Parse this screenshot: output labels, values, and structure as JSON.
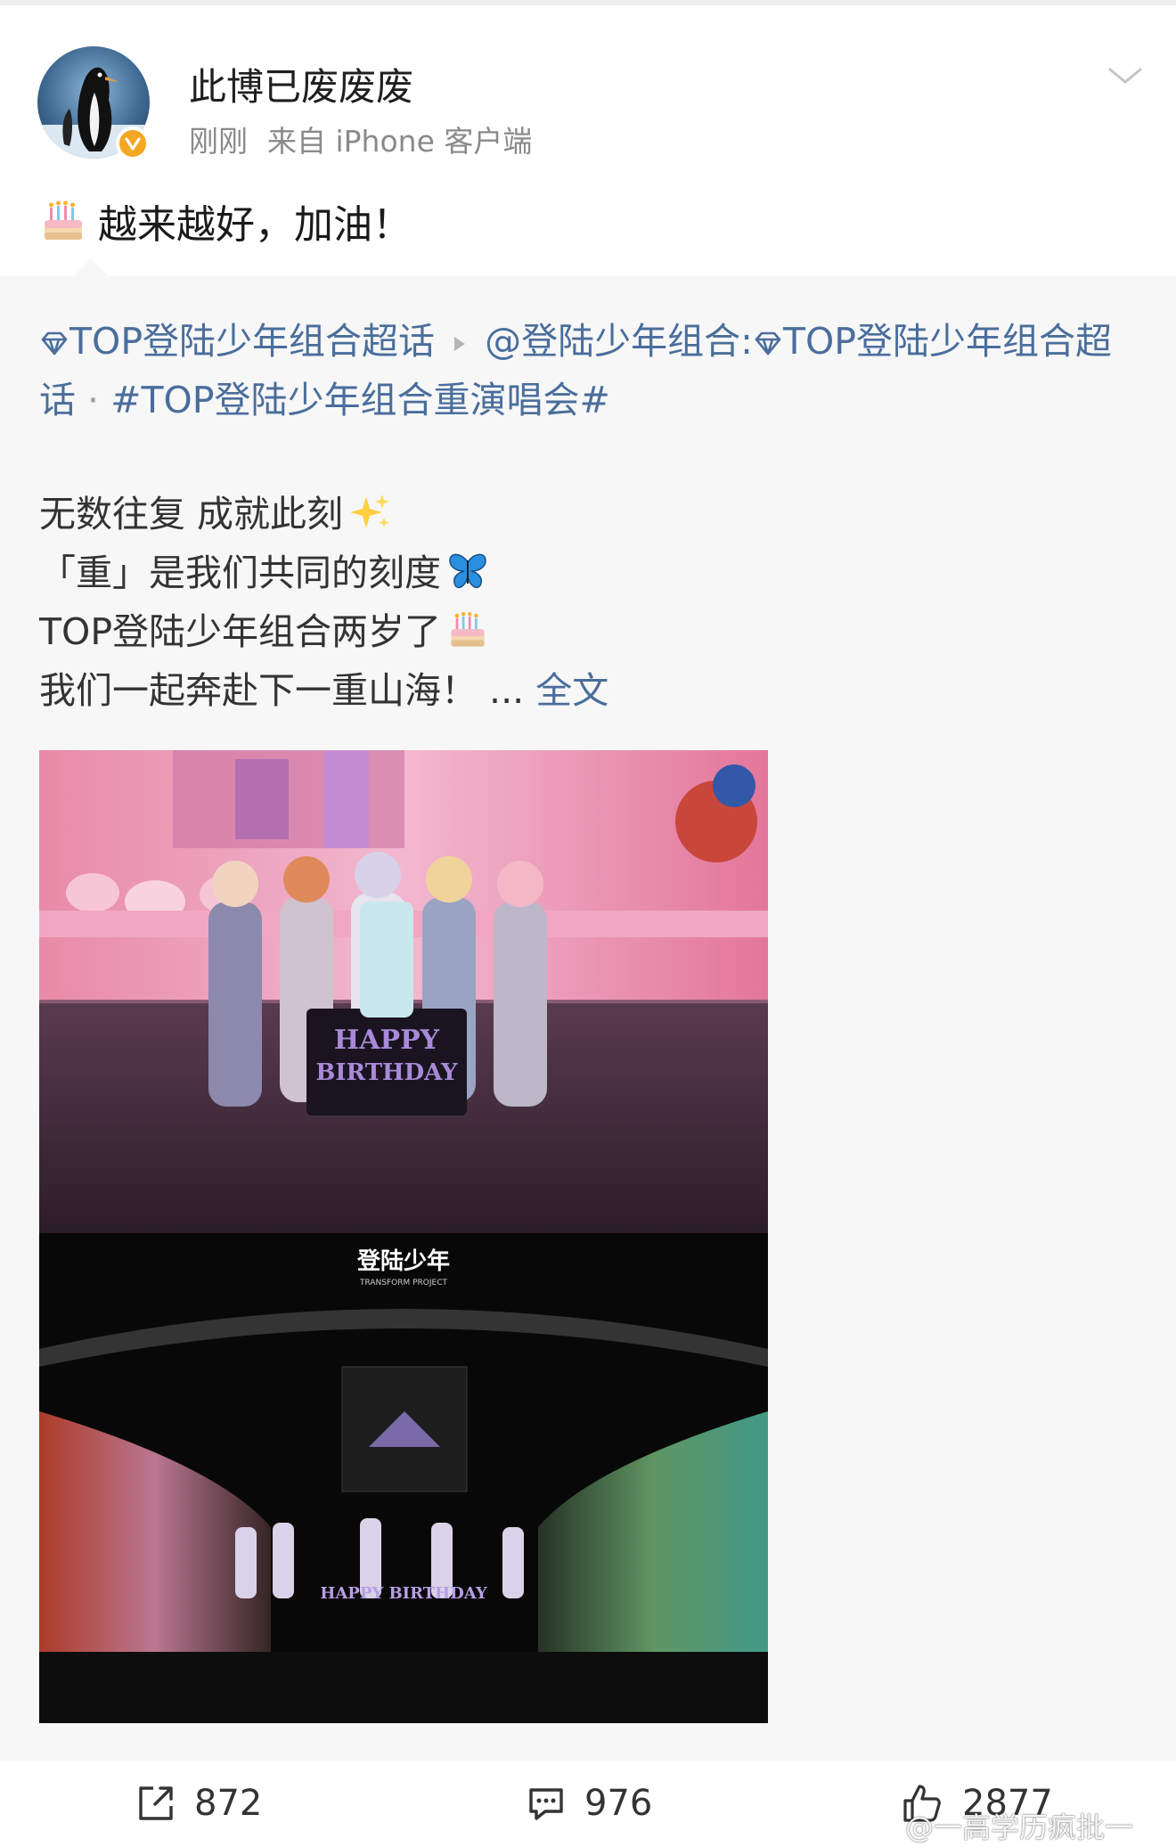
{
  "post": {
    "username": "此博已废废废",
    "time": "刚刚",
    "source": "来自 iPhone 客户端",
    "comment_text": "越来越好，加油！",
    "cake_icon": "cake-icon"
  },
  "repost": {
    "supertopic_1": "TOP登陆少年组合超话",
    "mention": "@登陆少年组合:",
    "supertopic_2": "TOP登陆少年组合超话",
    "separator": "·",
    "hashtag": "#TOP登陆少年组合重演唱会#",
    "lines": [
      "无数往复 成就此刻",
      "「重」是我们共同的刻度",
      "TOP登陆少年组合两岁了",
      "我们一起奔赴下一重山海！"
    ],
    "ellipsis": "...",
    "full_text_link": "全文",
    "photo_1": {
      "banner_text_1": "HAPPY",
      "banner_text_2": "BIRTHDAY"
    },
    "photo_2": {
      "logo_text": "登陆少年",
      "logo_sub": "TRANSFORM PROJECT",
      "banner_text": "HAPPY BIRTHDAY"
    }
  },
  "actions": {
    "share_count": "872",
    "comment_count": "976",
    "like_count": "2877"
  },
  "watermark": "@一高学历疯批一",
  "colors": {
    "link": "#4a6e9c",
    "meta_gray": "#8a8a8a",
    "verified": "#f5a623",
    "repost_bg": "#f7f7f7"
  }
}
